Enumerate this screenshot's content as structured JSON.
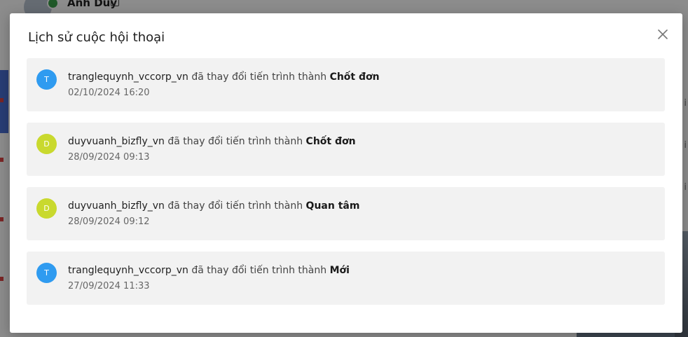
{
  "background": {
    "profile_name": "Anh Duy",
    "side_text": "i"
  },
  "modal": {
    "title": "Lịch sử cuộc hội thoại",
    "close_icon": "close-icon",
    "items": [
      {
        "avatar_letter": "T",
        "avatar_color": "#2f9bf0",
        "user": "tranglequynh_vccorp_vn",
        "action": "đã thay đổi tiến trình thành",
        "status": "Chốt đơn",
        "time": "02/10/2024 16:20"
      },
      {
        "avatar_letter": "D",
        "avatar_color": "#c9d92e",
        "user": "duyvuanh_bizfly_vn",
        "action": "đã thay đổi tiến trình thành",
        "status": "Chốt đơn",
        "time": "28/09/2024 09:13"
      },
      {
        "avatar_letter": "D",
        "avatar_color": "#c9d92e",
        "user": "duyvuanh_bizfly_vn",
        "action": "đã thay đổi tiến trình thành",
        "status": "Quan tâm",
        "time": "28/09/2024 09:12"
      },
      {
        "avatar_letter": "T",
        "avatar_color": "#2f9bf0",
        "user": "tranglequynh_vccorp_vn",
        "action": "đã thay đổi tiến trình thành",
        "status": "Mới",
        "time": "27/09/2024 11:33"
      }
    ]
  }
}
